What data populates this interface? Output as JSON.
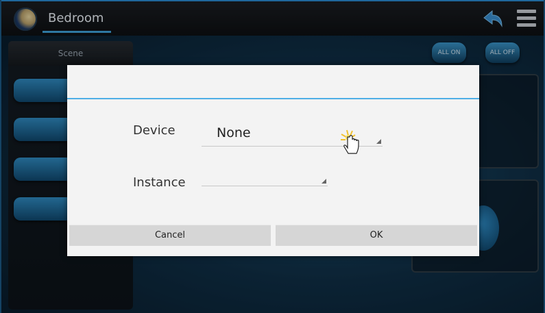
{
  "header": {
    "room_title": "Bedroom"
  },
  "scene_panel": {
    "header": "Scene"
  },
  "controls": {
    "all_on": "ALL ON",
    "all_off": "ALL OFF"
  },
  "dialog": {
    "device_label": "Device",
    "device_value": "None",
    "instance_label": "Instance",
    "instance_value": "",
    "cancel": "Cancel",
    "ok": "OK"
  },
  "colors": {
    "accent": "#4eaee6",
    "dialog_bg": "#f3f3f3",
    "button_bg": "#d6d6d6"
  },
  "icons": [
    "moon-logo-icon",
    "back-arrow-icon",
    "hamburger-menu-icon",
    "dropdown-arrow-icon",
    "hand-cursor-icon"
  ]
}
